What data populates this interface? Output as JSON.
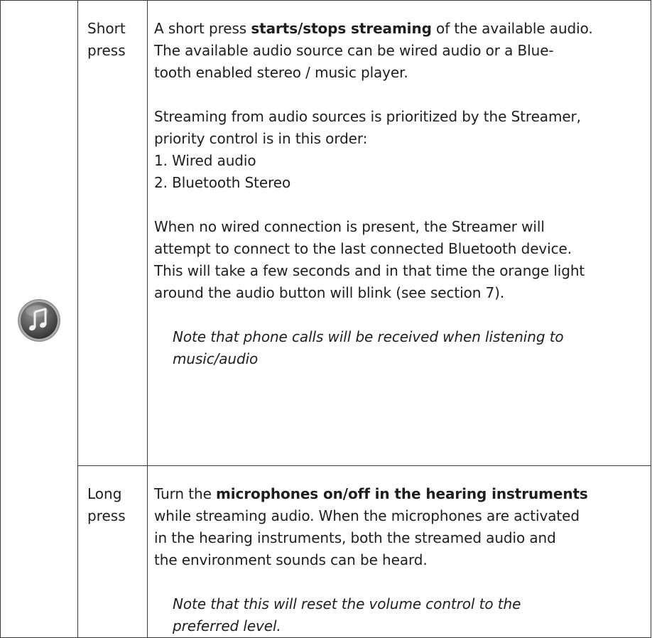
{
  "icon": {
    "name": "music-note-icon"
  },
  "rows": [
    {
      "label_line1": "Short",
      "label_line2": "press",
      "para1": {
        "pre": "A short press ",
        "bold": "starts/stops streaming",
        "post": " of the available audio.",
        "line2": "The available audio source can be wired audio or a Blue-",
        "line3": "tooth enabled stereo / music player."
      },
      "para2": {
        "line1": "Streaming from audio sources is prioritized by the Streamer,",
        "line2": "priority control is in this order:",
        "item1": "1. Wired audio",
        "item2": "2. Bluetooth Stereo"
      },
      "para3": {
        "line1": "When no wired connection is present, the Streamer will",
        "line2": "attempt to connect to the last connected Bluetooth device.",
        "line3": "This will take a few seconds and in that time the orange light",
        "line4": "around the audio button will blink (see section 7)."
      },
      "note": {
        "line1": "Note that phone calls will be received when listening to",
        "line2": "music/audio"
      }
    },
    {
      "label_line1": "Long",
      "label_line2": "press",
      "para1": {
        "pre": "Turn the ",
        "bold": "microphones on/off in the hearing instruments",
        "line2": "while streaming audio. When the microphones are activated",
        "line3": "in the hearing instruments, both the streamed audio and",
        "line4": "the environment sounds can be heard."
      },
      "note": {
        "line1": "Note that this will reset the volume control to the",
        "line2": "preferred level."
      }
    }
  ]
}
